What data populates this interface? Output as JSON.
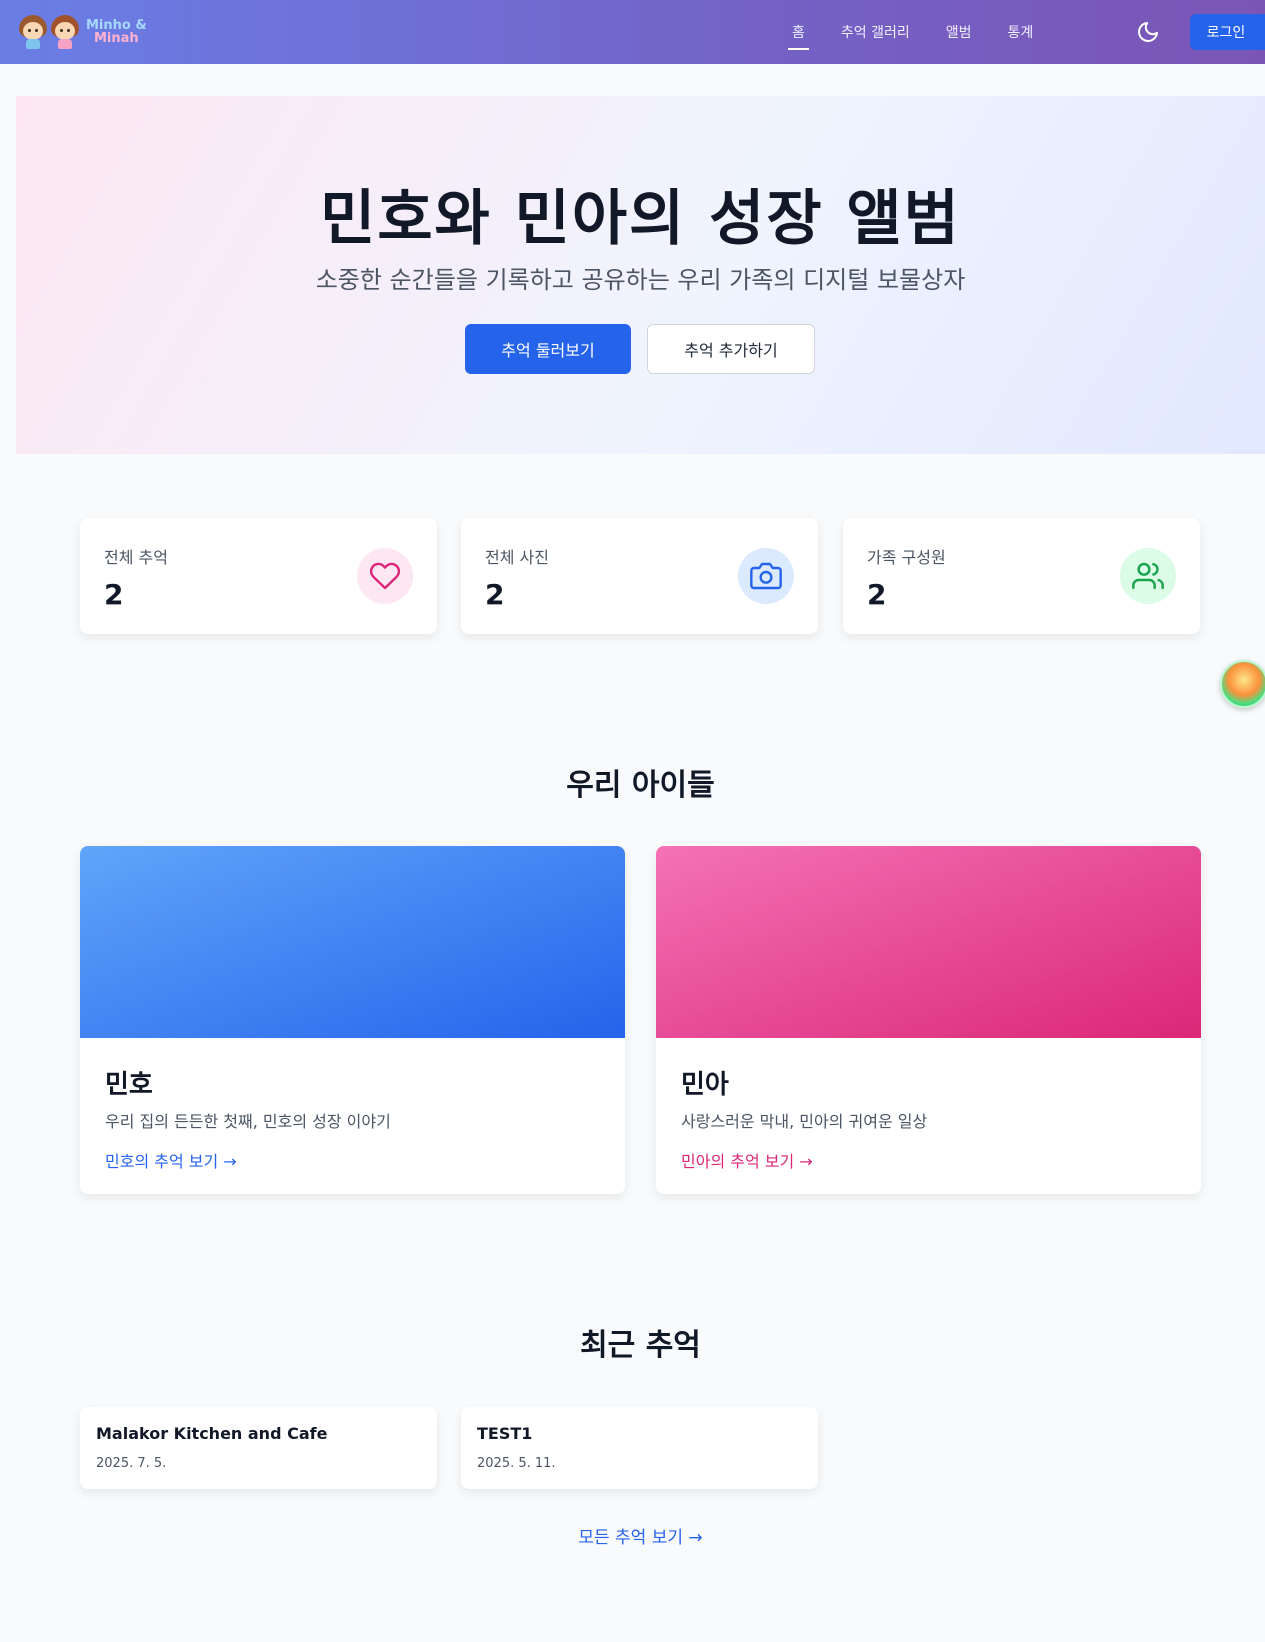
{
  "nav": {
    "logo_line1": "Minho &",
    "logo_line2": "Minah",
    "links": [
      {
        "label": "홈",
        "active": true
      },
      {
        "label": "추억 갤러리",
        "active": false
      },
      {
        "label": "앨범",
        "active": false
      },
      {
        "label": "통계",
        "active": false
      }
    ],
    "login_label": "로그인"
  },
  "hero": {
    "title": "민호와 민아의 성장 앨범",
    "subtitle": "소중한 순간들을 기록하고 공유하는 우리 가족의 디지털 보물상자",
    "primary_button": "추억 둘러보기",
    "secondary_button": "추억 추가하기"
  },
  "stats": [
    {
      "label": "전체 추억",
      "value": "2",
      "icon": "heart-icon",
      "color": "#db2777",
      "bg": "#fce7f3"
    },
    {
      "label": "전체 사진",
      "value": "2",
      "icon": "camera-icon",
      "color": "#2563eb",
      "bg": "#dbeafe"
    },
    {
      "label": "가족 구성원",
      "value": "2",
      "icon": "users-icon",
      "color": "#16a34a",
      "bg": "#dcfce7"
    }
  ],
  "kids_section": {
    "title": "우리 아이들",
    "kids": [
      {
        "name": "민호",
        "desc": "우리 집의 든든한 첫째, 민호의 성장 이야기",
        "link": "민호의 추억 보기 →",
        "color": "#2563eb"
      },
      {
        "name": "민아",
        "desc": "사랑스러운 막내, 민아의 귀여운 일상",
        "link": "민아의 추억 보기 →",
        "color": "#db2777"
      }
    ]
  },
  "recent_section": {
    "title": "최근 추억",
    "memories": [
      {
        "title": "Malakor Kitchen and Cafe",
        "date": "2025. 7. 5."
      },
      {
        "title": "TEST1",
        "date": "2025. 5. 11."
      }
    ],
    "all_link": "모든 추억 보기 →"
  }
}
